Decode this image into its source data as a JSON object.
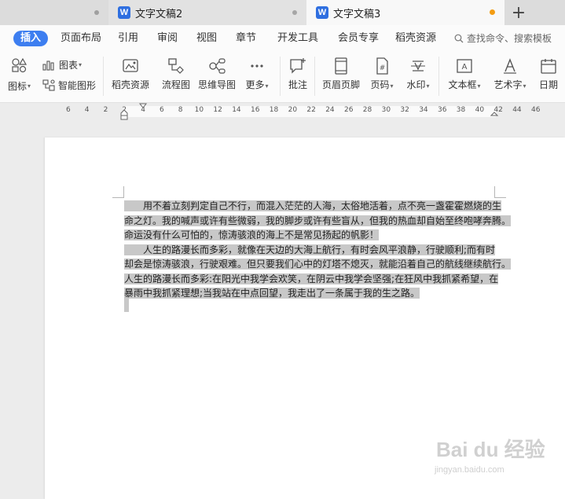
{
  "tabs": [
    {
      "title": "文字文稿2"
    },
    {
      "title": "文字文稿3"
    }
  ],
  "tab_add_glyph": "+",
  "menu": {
    "items": [
      "插入",
      "页面布局",
      "引用",
      "审阅",
      "视图",
      "章节",
      "开发工具",
      "会员专享",
      "稻壳资源"
    ],
    "active": "插入",
    "search_placeholder": "查找命令、搜索模板"
  },
  "toolbar": {
    "icon_label": "图标",
    "chart_label": "图表",
    "smartart_label": "智能图形",
    "daoke_label": "稻壳资源",
    "flowchart_label": "流程图",
    "mindmap_label": "思维导图",
    "more_label": "更多",
    "comment_label": "批注",
    "header_footer_label": "页眉页脚",
    "page_number_label": "页码",
    "watermark_label": "水印",
    "textbox_label": "文本框",
    "wordart_label": "艺术字",
    "date_label": "日期"
  },
  "ruler": {
    "numbers": [
      "6",
      "4",
      "2",
      "2",
      "4",
      "6",
      "8",
      "10",
      "12",
      "14",
      "16",
      "18",
      "20",
      "22",
      "24",
      "26",
      "28",
      "30",
      "32",
      "34",
      "36",
      "38",
      "40",
      "42",
      "44",
      "46"
    ]
  },
  "document": {
    "lines": [
      "　　用不着立刻判定自己不行，而混入茫茫的人海，太俗地活着，点不亮一盏霍霍燃烧的生",
      "命之灯。我的喊声或许有些微弱，我的脚步或许有些盲从，但我的热血却自始至终咆哮奔腾。",
      "命运没有什么可怕的，惊涛骇浪的海上不是常见扬起的帆影！",
      "　　人生的路漫长而多彩，就像在天边的大海上航行，有时会风平浪静，行驶顺利;而有时",
      "却会是惊涛骇浪，行驶艰难。但只要我们心中的灯塔不熄灭，就能沿着自己的航线继续航行。",
      "人生的路漫长而多彩:在阳光中我学会欢笑，在阴云中我学会坚强;在狂风中我抓紧希望，在",
      "暴雨中我抓紧理想;当我站在中点回望，我走出了一条属于我的生之路。"
    ]
  },
  "watermark": {
    "brand": "Bai du 经验",
    "url": "jingyan.baidu.com"
  },
  "colors": {
    "accent": "#3d7ef0",
    "selection": "#c8c8c8",
    "modified_dot": "#f39c12"
  }
}
